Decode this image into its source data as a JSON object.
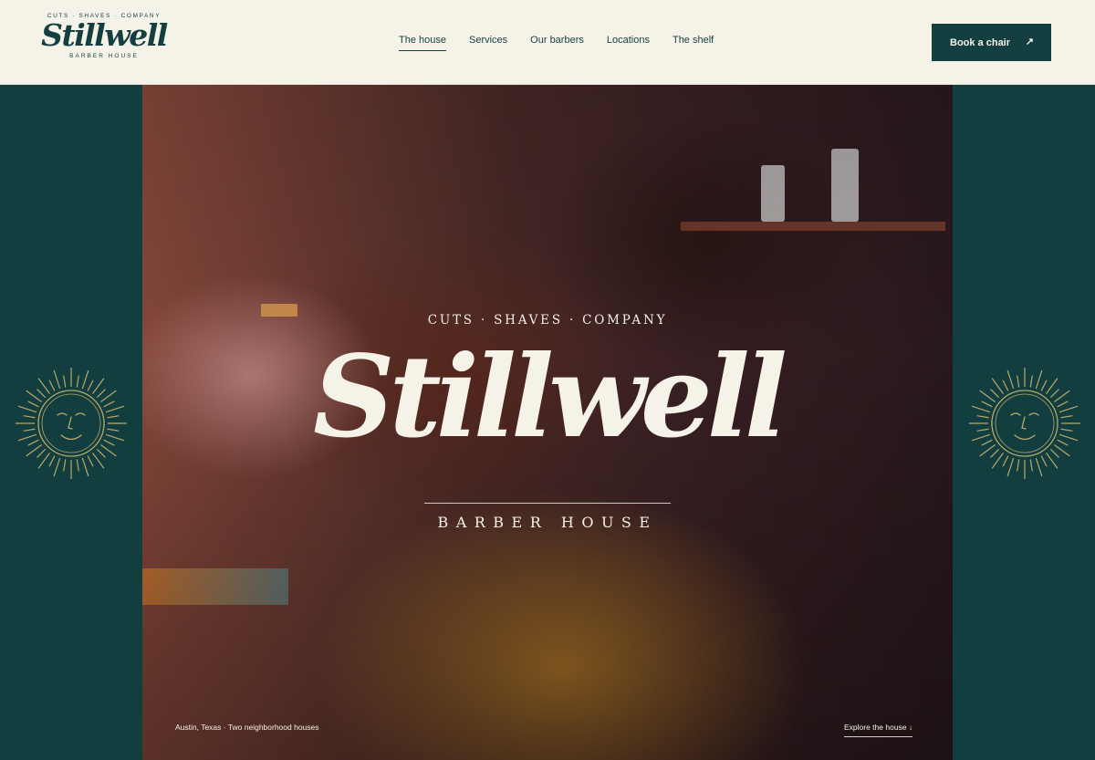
{
  "brand": {
    "tagline": "CUTS · SHAVES · COMPANY",
    "name": "Stillwell",
    "subtitle": "BARBER HOUSE"
  },
  "nav": {
    "items": [
      {
        "label": "The house",
        "active": true
      },
      {
        "label": "Services",
        "active": false
      },
      {
        "label": "Our barbers",
        "active": false
      },
      {
        "label": "Locations",
        "active": false
      },
      {
        "label": "The shelf",
        "active": false
      }
    ]
  },
  "cta": {
    "label": "Book a chair",
    "arrow": "↗"
  },
  "hero": {
    "tagline": "CUTS · SHAVES · COMPANY",
    "title": "Stillwell",
    "subtitle": "BARBER HOUSE",
    "location": "Austin, Texas · Two neighborhood houses",
    "explore": "Explore the house ↓"
  },
  "colors": {
    "cream": "#f5f2e8",
    "teal": "#143f40",
    "sun_gold": "#b8a868"
  },
  "icons": {
    "left_ornament": "sun-face-icon",
    "right_ornament": "sun-face-icon",
    "cta_icon": "arrow-up-right-icon"
  }
}
